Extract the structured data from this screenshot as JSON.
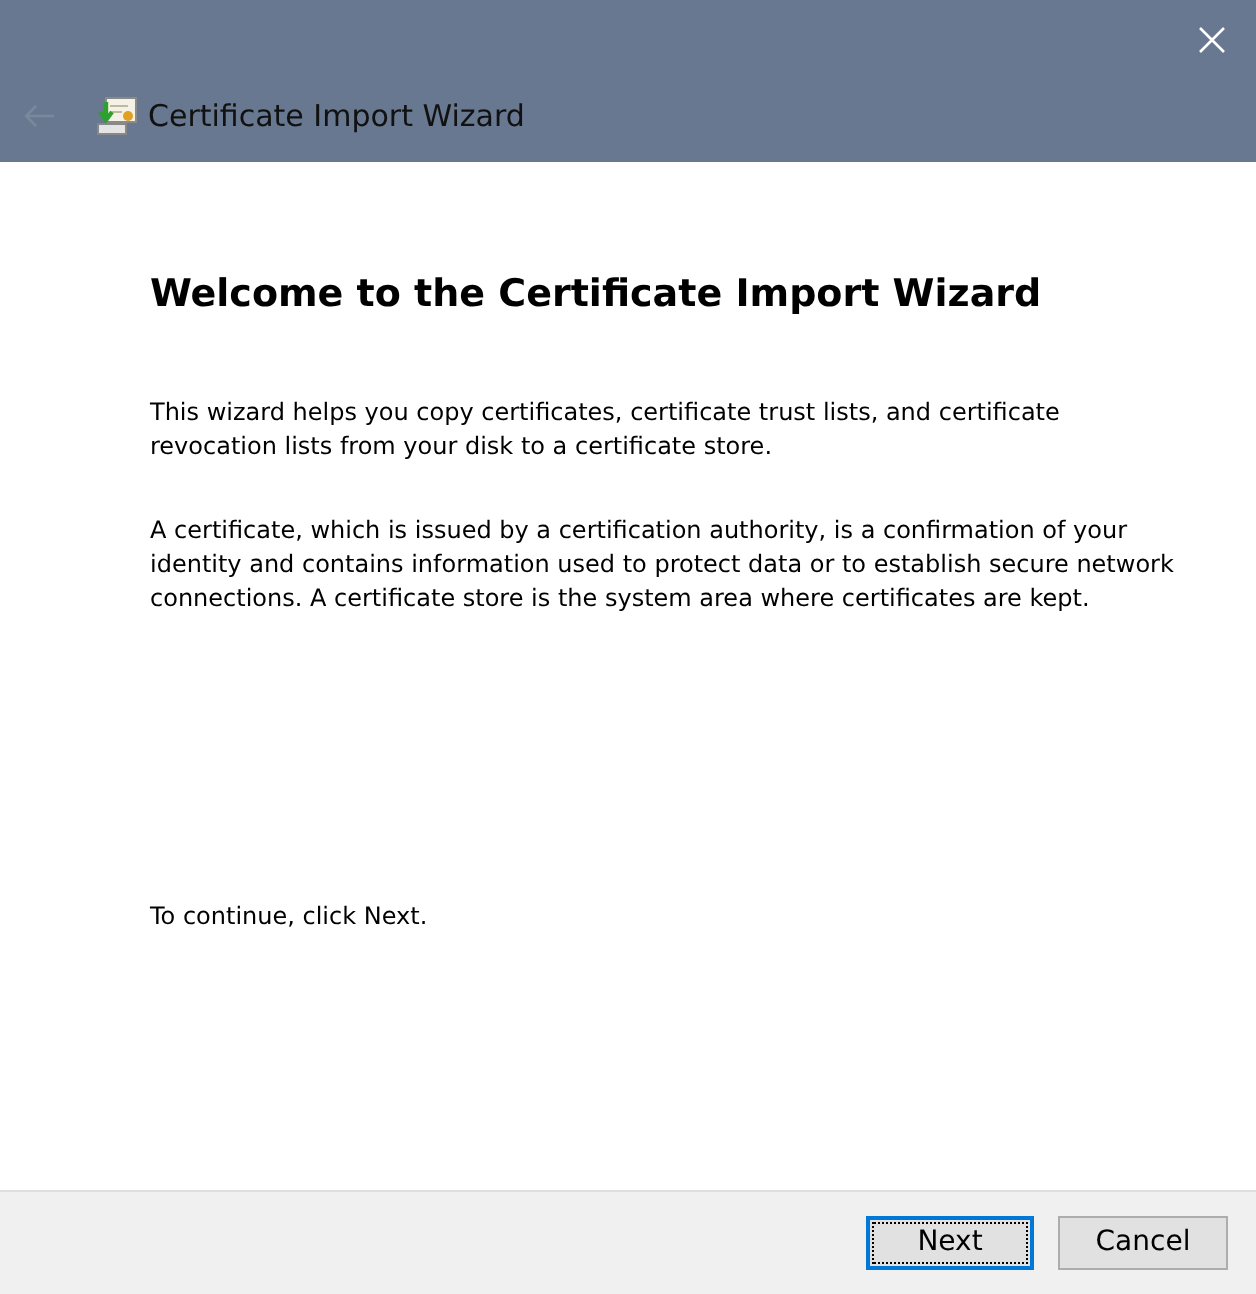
{
  "window": {
    "title": "Certificate Import Wizard",
    "back_disabled": true
  },
  "heading": "Welcome to the Certificate Import Wizard",
  "paragraphs": [
    "This wizard helps you copy certificates, certificate trust lists, and certificate revocation lists from your disk to a certificate store.",
    "A certificate, which is issued by a certification authority, is a confirmation of your identity and contains information used to protect data or to establish secure network connections. A certificate store is the system area where certificates are kept."
  ],
  "continue_text": "To continue, click Next.",
  "buttons": [
    {
      "label": "Next",
      "focused": true
    },
    {
      "label": "Cancel",
      "focused": false
    }
  ]
}
